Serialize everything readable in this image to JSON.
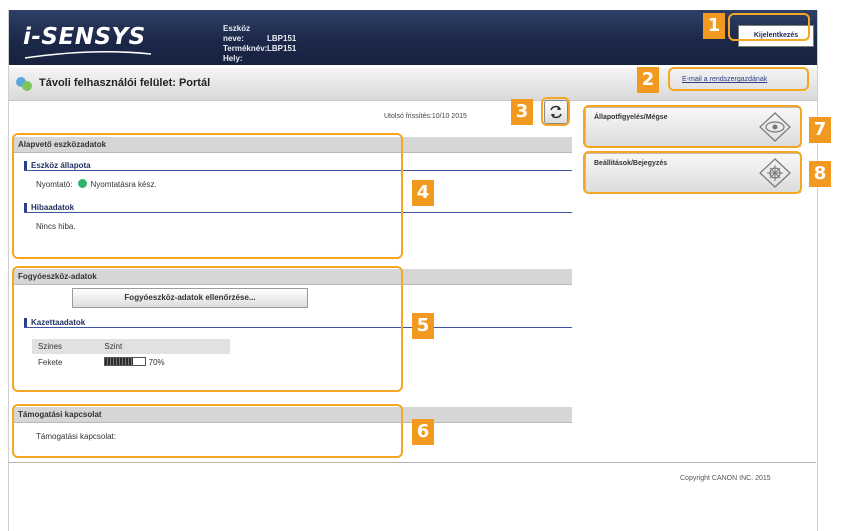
{
  "header": {
    "logo_text": "i-SENSYS",
    "device_name_label": "Eszköz neve:",
    "device_name_value": "LBP151",
    "product_label": "Terméknév:",
    "product_value": "LBP151",
    "location_label": "Hely:",
    "logout_label": "Kijelentkezés"
  },
  "titlebar": {
    "title": "Távoli felhasználói felület: Portál",
    "email_link": "E-mail a rendszergazdának"
  },
  "status": {
    "last_update": "Utolsó frissítés:10/10 2015",
    "refresh_icon": "refresh-icon"
  },
  "basic": {
    "title": "Alapvető eszközadatok",
    "device_status_heading": "Eszköz állapota",
    "printer_label": "Nyomtató:",
    "printer_status": "Nyomtatásra kész.",
    "status_color": "#2db36a",
    "error_heading": "Hibaadatok",
    "error_text": "Nincs hiba."
  },
  "consumables": {
    "title": "Fogyóeszköz-adatok",
    "check_button": "Fogyóeszköz-adatok ellenőrzése...",
    "cartridge_heading": "Kazettaadatok",
    "col_color": "Szines",
    "col_level": "Szint",
    "row_color": "Fekete",
    "row_level": "70%",
    "row_level_fraction": 0.7
  },
  "support": {
    "title": "Támogatási kapcsolat",
    "text": "Támogatási kapcsolat:"
  },
  "sidebar": {
    "monitor_button": "Állapotfigyelés/Mégse",
    "monitor_icon": "eye-icon",
    "settings_button": "Beállítások/Bejegyzés",
    "settings_icon": "settings-icon"
  },
  "callouts": [
    "1",
    "2",
    "3",
    "4",
    "5",
    "6",
    "7",
    "8"
  ],
  "accent_color": "#f29a1f",
  "footer": {
    "copyright": "Copyright CANON INC. 2015"
  }
}
